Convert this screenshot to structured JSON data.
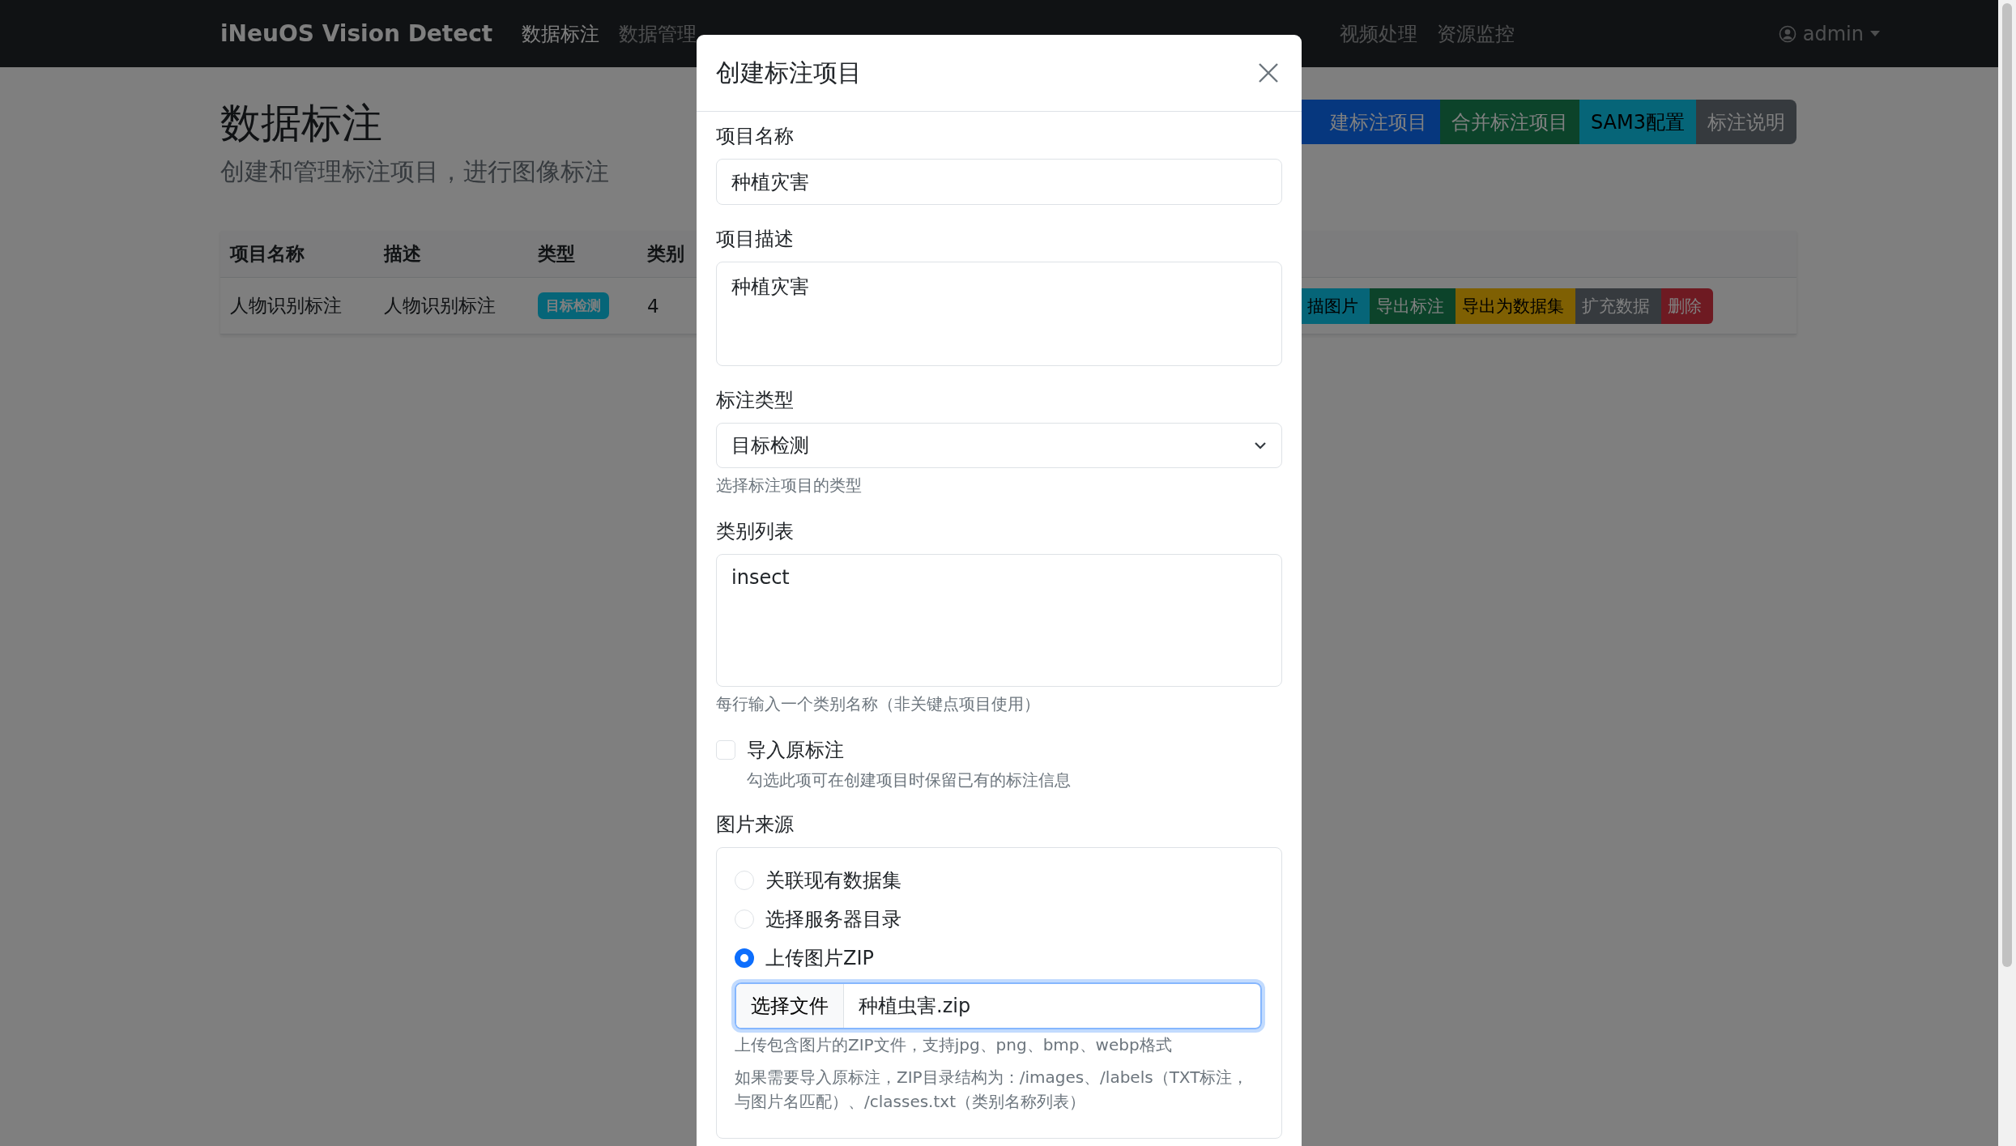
{
  "navbar": {
    "brand": "iNeuOS Vision Detect",
    "items": [
      {
        "label": "数据标注",
        "selected": true,
        "has_menu": false
      },
      {
        "label": "数据管理",
        "selected": false,
        "has_menu": false
      },
      {
        "label": "视频处理",
        "selected": false,
        "has_menu": false
      },
      {
        "label": "资源监控",
        "selected": false,
        "has_menu": false
      }
    ],
    "user": "admin"
  },
  "page": {
    "title": "数据标注",
    "subtitle": "创建和管理标注项目，进行图像标注",
    "actions": [
      {
        "label": "建标注项目",
        "color": "#06377e"
      },
      {
        "label": "合并标注项目",
        "color": "#0c432a"
      },
      {
        "label": "SAM3配置",
        "color": "#066578"
      },
      {
        "label": "标注说明",
        "color": "#363a3e"
      }
    ]
  },
  "table": {
    "columns": [
      "项目名称",
      "描述",
      "类型",
      "类别"
    ],
    "rows": [
      {
        "name": "人物识别标注",
        "description": "人物识别标注",
        "type": "目标检测",
        "class_count": "4",
        "actions": [
          {
            "label": "描图片",
            "color": "#066578"
          },
          {
            "label": "导出标注",
            "color": "#0c432a"
          },
          {
            "label": "导出为数据集",
            "color": "#7f6003"
          },
          {
            "label": "扩充数据",
            "color": "#363a3e"
          },
          {
            "label": "删除",
            "color": "#6e1a22"
          }
        ]
      }
    ]
  },
  "modal": {
    "title": "创建标注项目",
    "fields": [
      {
        "kind": "text",
        "label": "项目名称",
        "value": "种植灾害"
      },
      {
        "kind": "textarea",
        "label": "项目描述",
        "value": "种植灾害"
      },
      {
        "kind": "select",
        "label": "标注类型",
        "value": "目标检测",
        "help": "选择标注项目的类型"
      },
      {
        "kind": "textarea_tall",
        "label": "类别列表",
        "value": "insect",
        "help": "每行输入一个类别名称（非关键点项目使用）"
      },
      {
        "kind": "checkbox",
        "label": "导入原标注",
        "checked": false,
        "help": "勾选此项可在创建项目时保留已有的标注信息"
      }
    ],
    "image_source": {
      "label": "图片来源",
      "options": [
        {
          "label": "关联现有数据集",
          "selected": false
        },
        {
          "label": "选择服务器目录",
          "selected": false
        },
        {
          "label": "上传图片ZIP",
          "selected": true
        }
      ],
      "file": {
        "button": "选择文件",
        "filename": "种植虫害.zip"
      },
      "help": [
        "上传包含图片的ZIP文件，支持jpg、png、bmp、webp格式",
        "如果需要导入原标注，ZIP目录结构为：/images、/labels（TXT标注，与图片名匹配）、/classes.txt（类别名称列表）"
      ]
    }
  }
}
